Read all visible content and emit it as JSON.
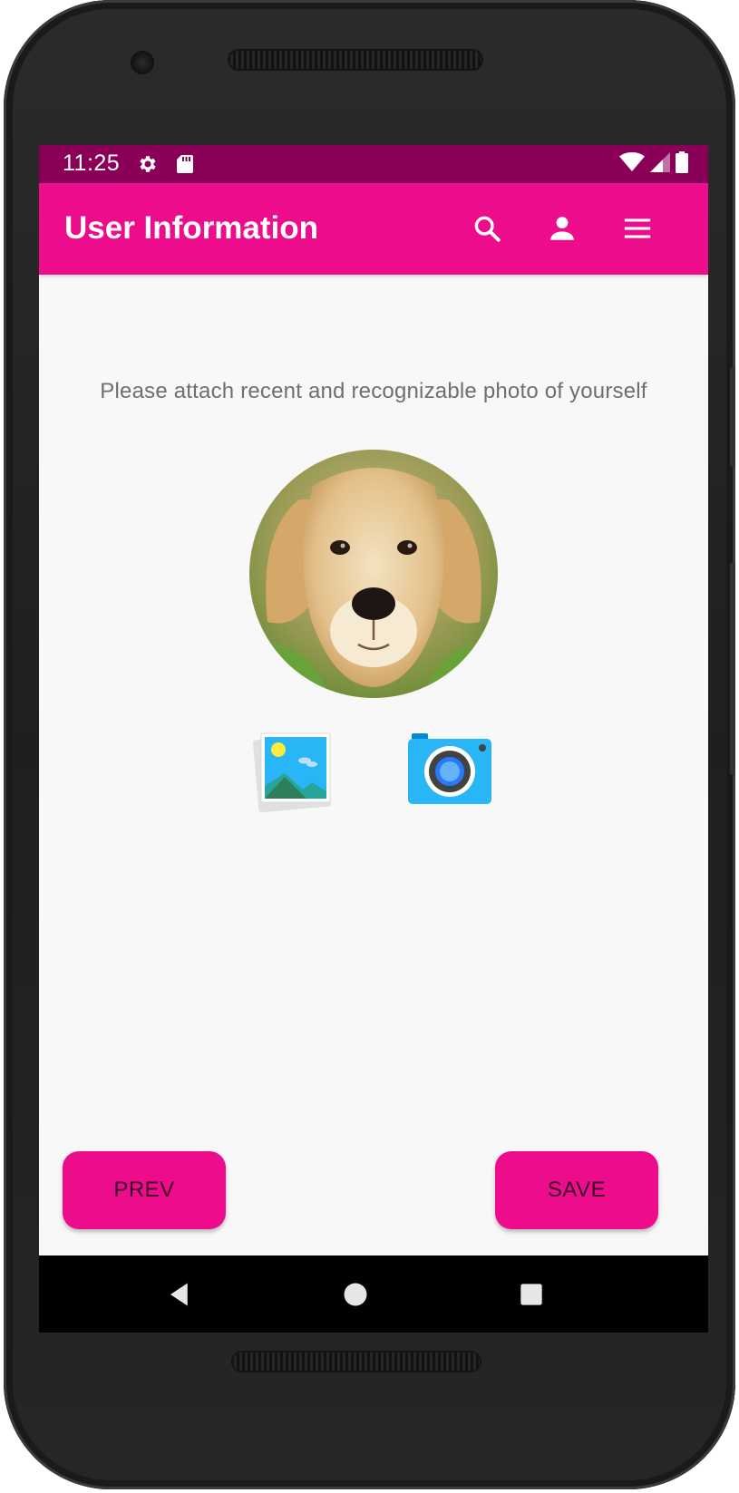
{
  "status_bar": {
    "time": "11:25",
    "icons": [
      "gear-icon",
      "sd-card-icon",
      "wifi-icon",
      "signal-icon",
      "battery-icon"
    ]
  },
  "app_bar": {
    "title": "User Information",
    "actions": [
      "search-icon",
      "account-icon",
      "menu-icon"
    ],
    "color": "#ec0c8c"
  },
  "content": {
    "prompt": "Please attach recent and recognizable photo of yourself",
    "photo": "profile-photo",
    "pickers": [
      "gallery-icon",
      "camera-icon"
    ]
  },
  "buttons": {
    "prev_label": "PREV",
    "save_label": "SAVE",
    "color": "#ec0c8c"
  },
  "nav_bar": {
    "items": [
      "back-icon",
      "home-icon",
      "recents-icon"
    ]
  },
  "colors": {
    "status_bar": "#8a0059",
    "background": "#f8f8f8",
    "prompt_text": "#6f6f6f"
  }
}
